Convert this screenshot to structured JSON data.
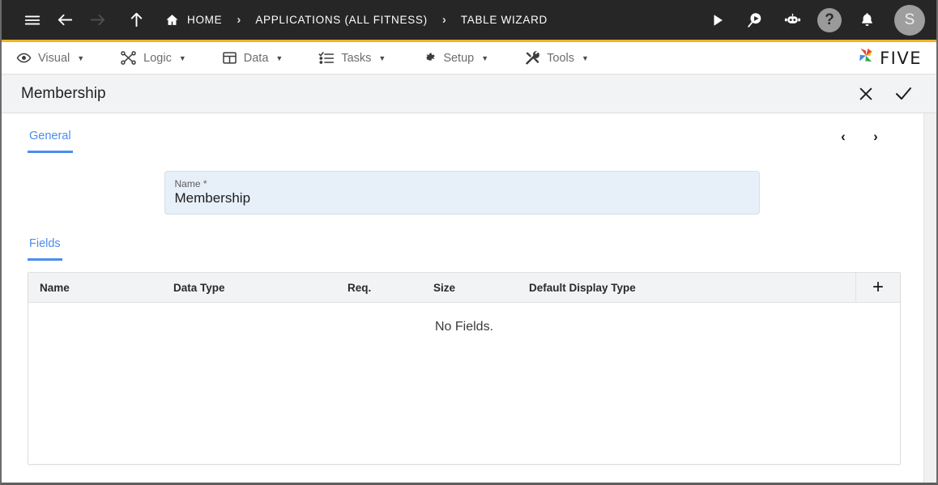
{
  "topbar": {
    "icons": {
      "menu": "hamburger-icon",
      "back": "arrow-left-icon",
      "forward": "arrow-right-icon",
      "up": "arrow-up-icon",
      "home": "home-icon",
      "run": "play-icon",
      "search_run": "search-play-icon",
      "bot": "robot-icon",
      "help": "help-icon",
      "notifications": "bell-icon"
    },
    "breadcrumbs": [
      {
        "label": "HOME",
        "icon": "home-icon"
      },
      {
        "label": "APPLICATIONS (ALL FITNESS)",
        "icon": ""
      },
      {
        "label": "TABLE WIZARD",
        "icon": ""
      }
    ],
    "separator": "›",
    "help_glyph": "?",
    "avatar_initial": "S",
    "accent_bar_color": "#f0b323",
    "background_color": "#262626"
  },
  "menubar": {
    "items": [
      {
        "label": "Visual",
        "icon": "eye-icon",
        "caret": "▼"
      },
      {
        "label": "Logic",
        "icon": "logic-nodes-icon",
        "caret": "▼"
      },
      {
        "label": "Data",
        "icon": "table-icon",
        "caret": "▼"
      },
      {
        "label": "Tasks",
        "icon": "checklist-icon",
        "caret": "▼"
      },
      {
        "label": "Setup",
        "icon": "gear-icon",
        "caret": "▼"
      },
      {
        "label": "Tools",
        "icon": "tools-icon",
        "caret": "▼"
      }
    ],
    "brand": {
      "text": "FIVE",
      "logo": "five-pinwheel-logo"
    }
  },
  "page_header": {
    "title": "Membership",
    "cancel_icon": "close-icon",
    "confirm_icon": "check-icon"
  },
  "general_section": {
    "tab_label": "General",
    "prev_icon": "‹",
    "next_icon": "›",
    "name_field": {
      "label": "Name *",
      "value": "Membership",
      "placeholder": "Name"
    }
  },
  "fields_section": {
    "tab_label": "Fields",
    "add_icon": "+",
    "columns": [
      "Name",
      "Data Type",
      "Req.",
      "Size",
      "Default Display Type"
    ],
    "rows": [],
    "empty_message": "No Fields."
  },
  "colors": {
    "accent_blue": "#4a8df0",
    "top_accent": "#f0b323",
    "field_bg": "#e7eff9",
    "header_bg": "#f2f3f5"
  }
}
